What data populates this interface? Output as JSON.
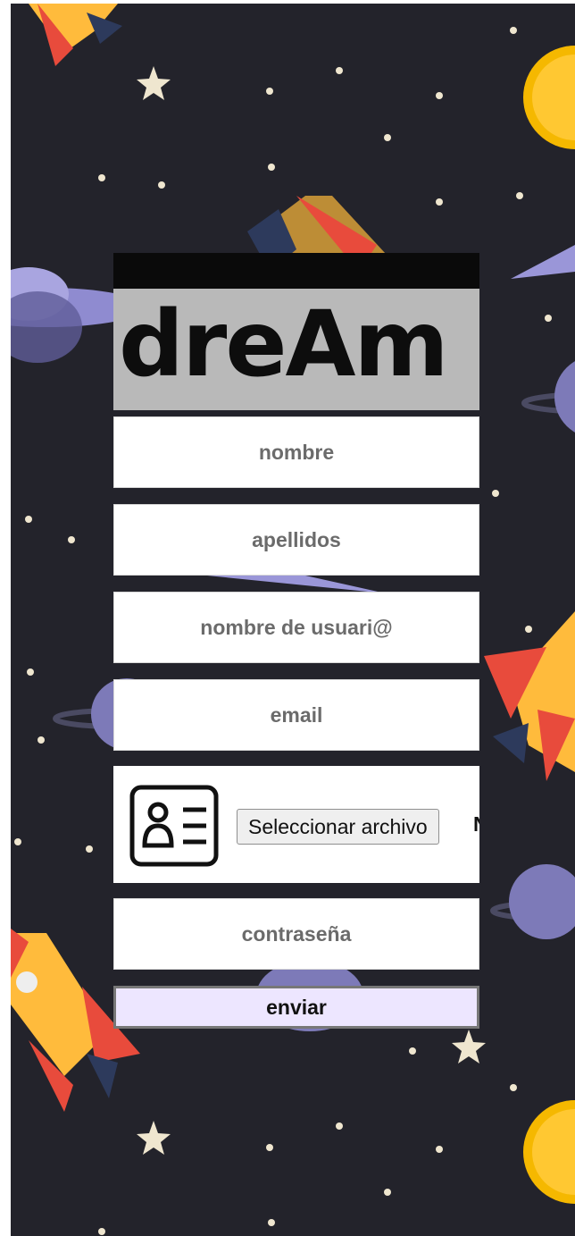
{
  "logo": {
    "text": "dreAm"
  },
  "fields": {
    "nombre": {
      "placeholder": "nombre"
    },
    "apellidos": {
      "placeholder": "apellidos"
    },
    "usuario": {
      "placeholder": "nombre de usuari@"
    },
    "email": {
      "placeholder": "email"
    },
    "contrasena": {
      "placeholder": "contraseña"
    }
  },
  "avatar_upload": {
    "icon": "id-card-icon",
    "button_label": "Seleccionar archivo",
    "status_text": "N"
  },
  "submit": {
    "label": "enviar"
  },
  "colors": {
    "background": "#23232b",
    "submit_bg": "#ede6ff",
    "field_text": "#6b6b6b"
  }
}
